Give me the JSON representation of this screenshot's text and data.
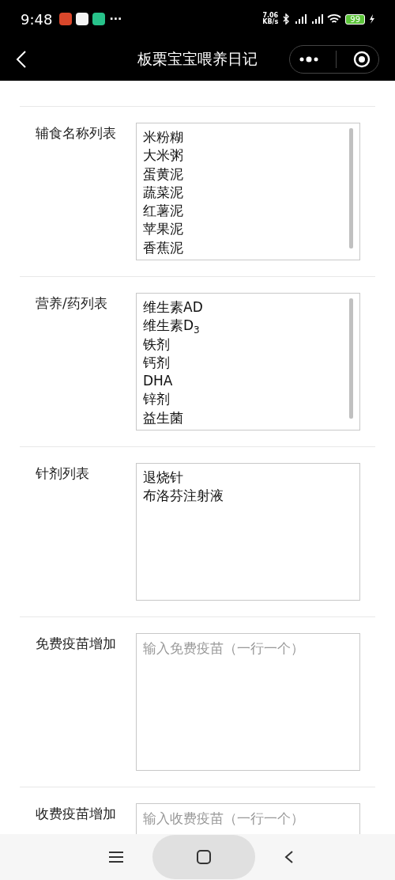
{
  "status_bar": {
    "time": "9:48",
    "more": "···",
    "speed_value": "7.06",
    "speed_unit": "KB/s",
    "battery": "99"
  },
  "nav": {
    "title": "板栗宝宝喂养日记"
  },
  "sections": [
    {
      "label": "辅食名称列表",
      "lines": [
        "米粉糊",
        "大米粥",
        "蛋黄泥",
        "蔬菜泥",
        "红薯泥",
        "苹果泥",
        "香蕉泥"
      ]
    },
    {
      "label": "营养/药列表",
      "lines": [
        "维生素AD",
        "维生素D$_{3}$",
        "铁剂",
        "钙剂",
        "DHA",
        "锌剂",
        "益生菌"
      ]
    },
    {
      "label": "针剂列表",
      "lines": [
        "退烧针",
        "布洛芬注射液"
      ]
    },
    {
      "label": "免费疫苗增加",
      "placeholder": "输入免费疫苗（一行一个）"
    },
    {
      "label": "收费疫苗增加",
      "placeholder": "输入收费疫苗（一行一个）"
    }
  ]
}
